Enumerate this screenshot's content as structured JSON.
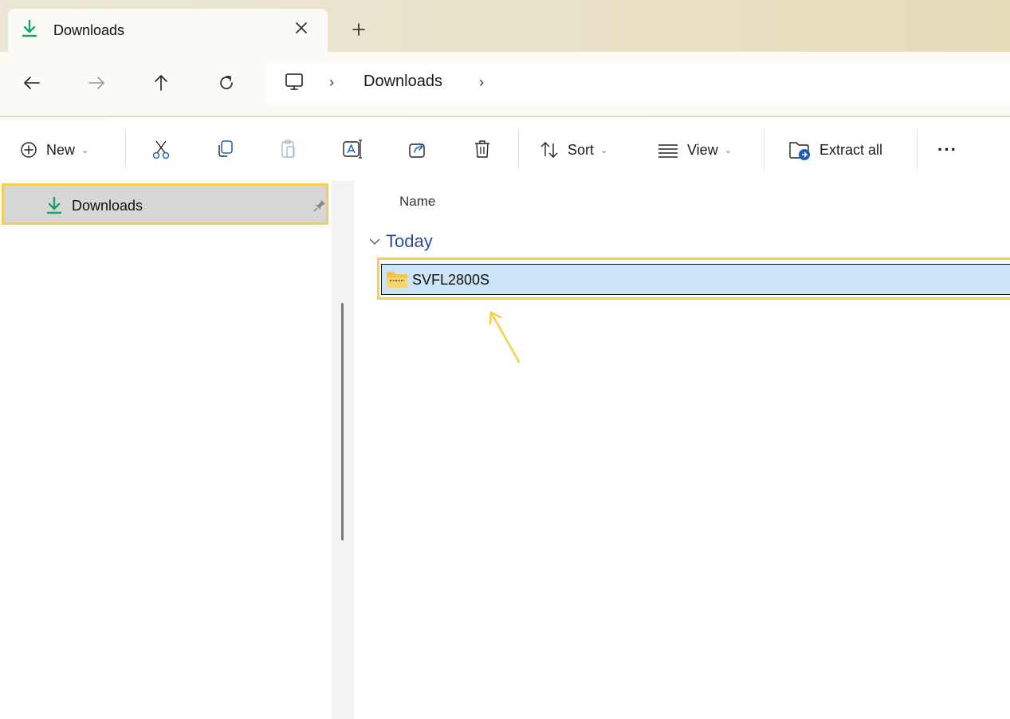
{
  "tab": {
    "title": "Downloads"
  },
  "address": {
    "crumbs": [
      "Downloads"
    ]
  },
  "toolbar": {
    "new_label": "New",
    "sort_label": "Sort",
    "view_label": "View",
    "extract_label": "Extract all",
    "more_label": "···"
  },
  "sidebar": {
    "items": [
      {
        "label": "Downloads",
        "icon": "download-icon",
        "pinned": true
      }
    ]
  },
  "content": {
    "column_header": "Name",
    "groups": [
      {
        "label": "Today",
        "items": [
          {
            "name": "SVFL2800S",
            "icon": "zip-folder-icon",
            "selected": true
          }
        ]
      }
    ]
  },
  "colors": {
    "accent_green": "#1aa36b",
    "highlight": "#f5cf4f",
    "selection": "#cce4f7",
    "group_text": "#2b4aa3"
  }
}
